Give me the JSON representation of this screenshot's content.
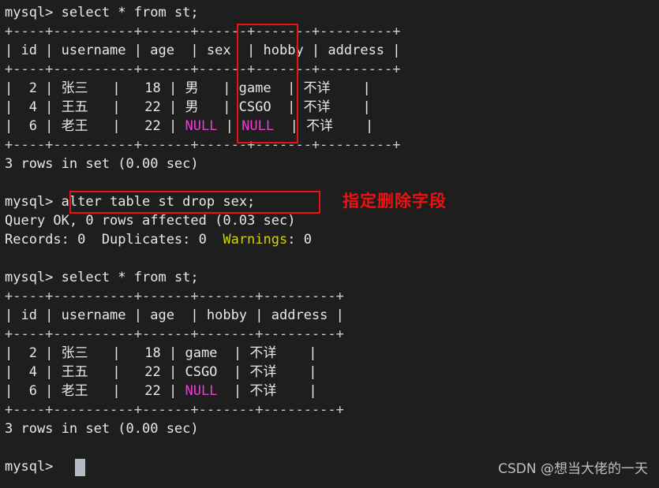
{
  "terminal": {
    "background_color": "#1e1e1e",
    "foreground_color": "#e8e8e8",
    "null_color": "#e83fd0",
    "warning_color": "#d4d400",
    "annotation_color": "#ee1111",
    "prompt": "mysql> ",
    "cursor_symbol": "block-cursor"
  },
  "lines": {
    "l01_prompt": "mysql> ",
    "l01_command": "select * from st;",
    "l02_rule": "+----+----------+------+------+-------+---------+",
    "l03_header": "| id | username | age  | sex  | hobby | address |",
    "l04_rule": "+----+----------+------+------+-------+---------+",
    "l05_row1_a": "|  2 | ",
    "l05_row1_name": "张三",
    "l05_row1_b": "   |   18 | ",
    "l05_row1_sex": "男",
    "l05_row1_c": "   | game  | ",
    "l05_row1_addr": "不详",
    "l05_row1_d": "    |",
    "l06_row2_a": "|  4 | ",
    "l06_row2_name": "王五",
    "l06_row2_b": "   |   22 | ",
    "l06_row2_sex": "男",
    "l06_row2_c": "   | CSGO  | ",
    "l06_row2_addr": "不详",
    "l06_row2_d": "    |",
    "l07_row3_a": "|  6 | ",
    "l07_row3_name": "老王",
    "l07_row3_b": "   |   22 | ",
    "l07_row3_null_sex": "NULL",
    "l07_row3_c": " | ",
    "l07_row3_null_hobby": "NULL",
    "l07_row3_d": "  | ",
    "l07_row3_addr": "不详",
    "l07_row3_e": "    |",
    "l08_rule": "+----+----------+------+------+-------+---------+",
    "l09_result": "3 rows in set (0.00 sec)",
    "l10_blank": "",
    "l11_prompt": "mysql> ",
    "l11_command": "alter table st drop sex;",
    "l12_queryok": "Query OK, 0 rows affected (0.03 sec)",
    "l13_records_a": "Records: 0  Duplicates: 0  ",
    "l13_warnings_label": "Warnings",
    "l13_warnings_rest": ": 0",
    "l14_blank": "",
    "l15_prompt": "mysql> ",
    "l15_command": "select * from st;",
    "l16_rule": "+----+----------+------+-------+---------+",
    "l17_header": "| id | username | age  | hobby | address |",
    "l18_rule": "+----+----------+------+-------+---------+",
    "l19_row1_a": "|  2 | ",
    "l19_row1_name": "张三",
    "l19_row1_b": "   |   18 | game  | ",
    "l19_row1_addr": "不详",
    "l19_row1_c": "    |",
    "l20_row2_a": "|  4 | ",
    "l20_row2_name": "王五",
    "l20_row2_b": "   |   22 | CSGO  | ",
    "l20_row2_addr": "不详",
    "l20_row2_c": "    |",
    "l21_row3_a": "|  6 | ",
    "l21_row3_name": "老王",
    "l21_row3_b": "   |   22 | ",
    "l21_row3_null_hobby": "NULL",
    "l21_row3_c": "  | ",
    "l21_row3_addr": "不详",
    "l21_row3_d": "    |",
    "l22_rule": "+----+----------+------+-------+---------+",
    "l23_result": "3 rows in set (0.00 sec)",
    "l24_blank": "",
    "l25_prompt": "mysql> "
  },
  "annotations": {
    "drop_field_note": "指定删除字段",
    "highlight_sex_column": "sex-column-highlight",
    "highlight_alter_command": "alter-command-highlight"
  },
  "watermark": {
    "text": "CSDN @想当大佬的一天"
  },
  "table_before": {
    "columns": [
      "id",
      "username",
      "age",
      "sex",
      "hobby",
      "address"
    ],
    "rows": [
      [
        "2",
        "张三",
        "18",
        "男",
        "game",
        "不详"
      ],
      [
        "4",
        "王五",
        "22",
        "男",
        "CSGO",
        "不详"
      ],
      [
        "6",
        "老王",
        "22",
        "NULL",
        "NULL",
        "不详"
      ]
    ],
    "row_count_text": "3 rows in set (0.00 sec)"
  },
  "table_after": {
    "columns": [
      "id",
      "username",
      "age",
      "hobby",
      "address"
    ],
    "rows": [
      [
        "2",
        "张三",
        "18",
        "game",
        "不详"
      ],
      [
        "4",
        "王五",
        "22",
        "CSGO",
        "不详"
      ],
      [
        "6",
        "老王",
        "22",
        "NULL",
        "不详"
      ]
    ],
    "row_count_text": "3 rows in set (0.00 sec)"
  }
}
